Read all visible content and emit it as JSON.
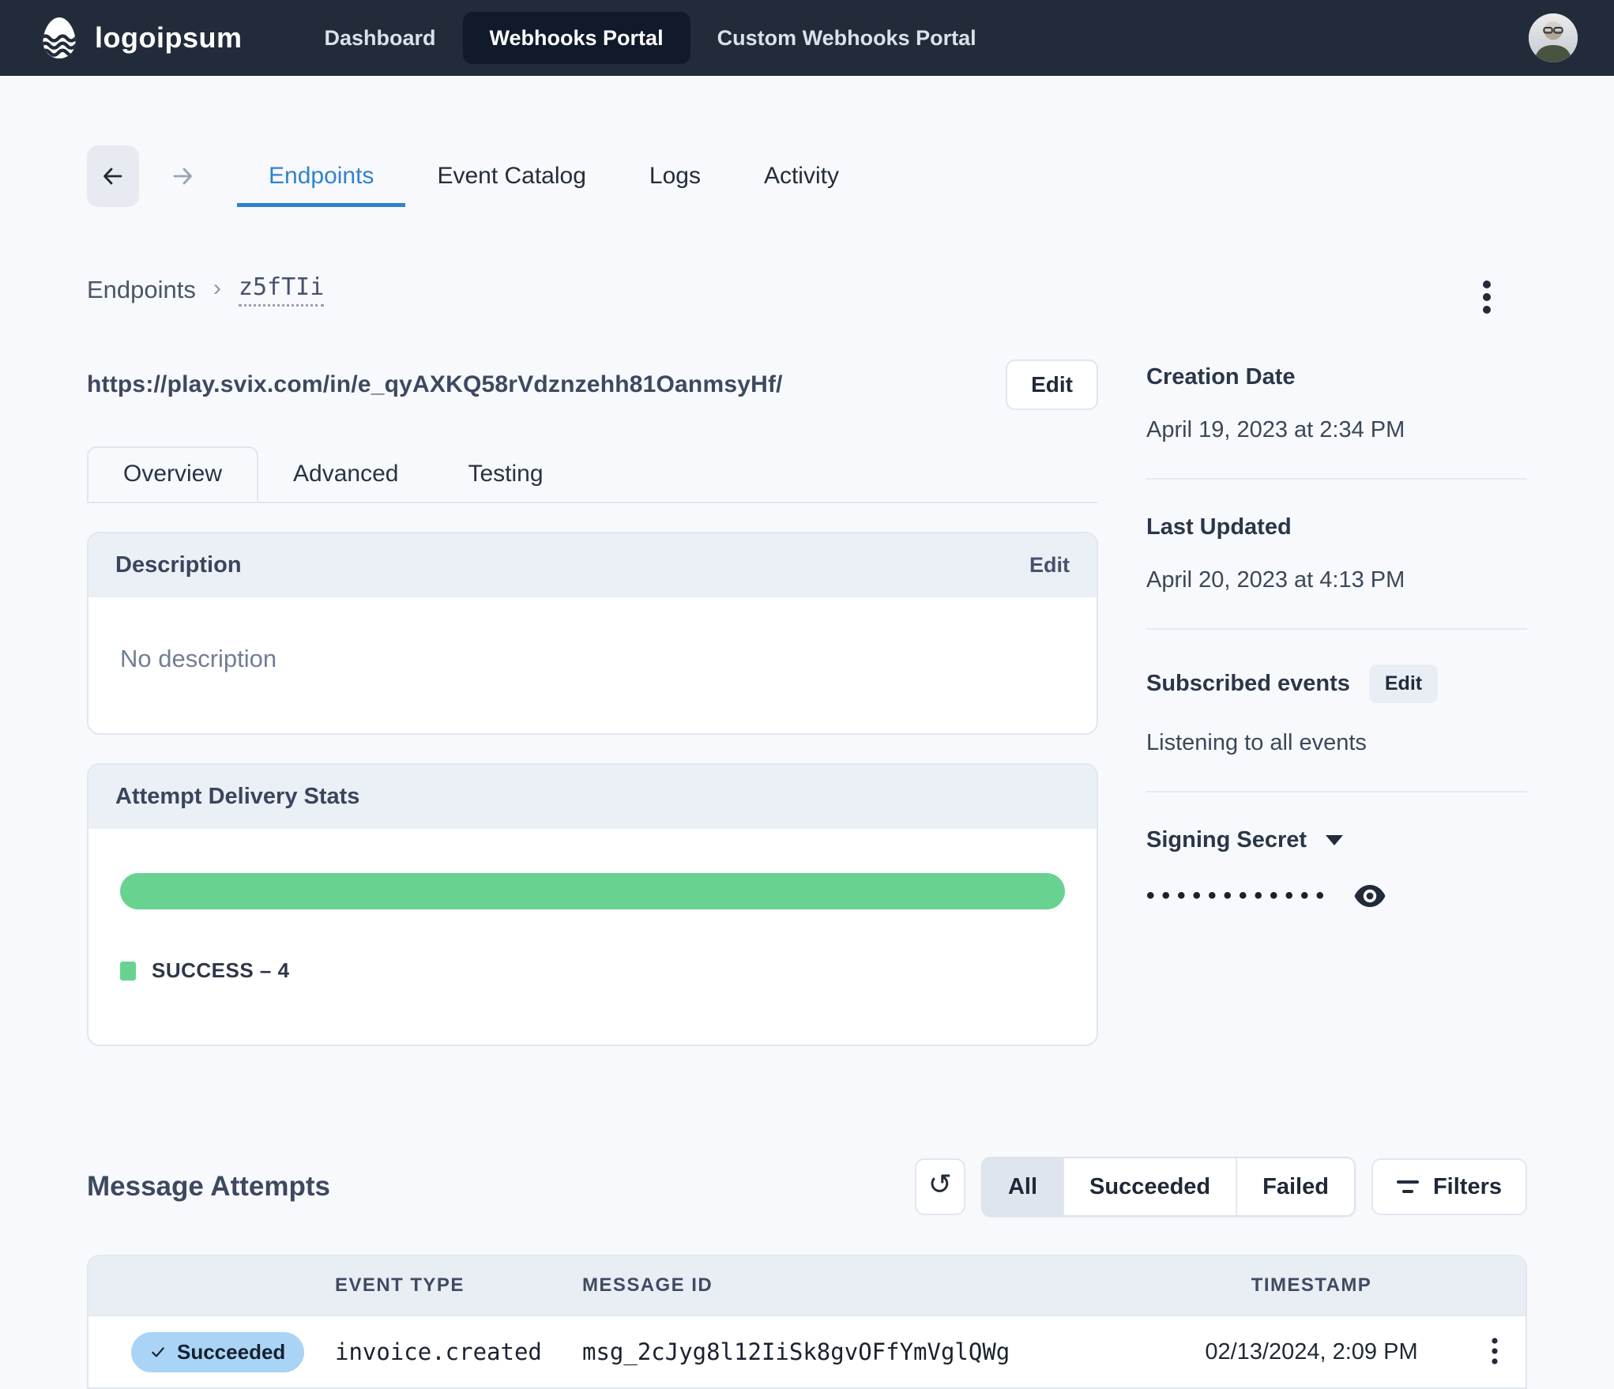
{
  "theme": {
    "navbar_bg": "#222b3a",
    "navbar_active_bg": "#111a2b",
    "accent_blue": "#3182ce",
    "success_green": "#68d391",
    "succeeded_badge_bg": "#aad4f5"
  },
  "navbar": {
    "logo_text": "logoipsum",
    "items": [
      {
        "label": "Dashboard",
        "active": false
      },
      {
        "label": "Webhooks Portal",
        "active": true
      },
      {
        "label": "Custom Webhooks Portal",
        "active": false
      }
    ]
  },
  "portal_tabs": {
    "items": [
      {
        "label": "Endpoints",
        "active": true
      },
      {
        "label": "Event Catalog",
        "active": false
      },
      {
        "label": "Logs",
        "active": false
      },
      {
        "label": "Activity",
        "active": false
      }
    ]
  },
  "breadcrumb": {
    "root": "Endpoints",
    "separator": "›",
    "current": "z5fTIi"
  },
  "endpoint": {
    "url": "https://play.svix.com/in/e_qyAXKQ58rVdznzehh81OanmsyHf/",
    "edit_button": "Edit"
  },
  "detail_tabs": {
    "items": [
      {
        "label": "Overview",
        "active": true
      },
      {
        "label": "Advanced",
        "active": false
      },
      {
        "label": "Testing",
        "active": false
      }
    ]
  },
  "description_card": {
    "title": "Description",
    "edit_button": "Edit",
    "empty_text": "No description"
  },
  "delivery_stats": {
    "title": "Attempt Delivery Stats",
    "legend_label": "SUCCESS – 4",
    "series": [
      {
        "name": "SUCCESS",
        "count": 4,
        "percent": 100,
        "color": "#68d391"
      }
    ]
  },
  "sidebar": {
    "creation_date_label": "Creation Date",
    "creation_date_value": "April 19, 2023 at 2:34 PM",
    "last_updated_label": "Last Updated",
    "last_updated_value": "April 20, 2023 at 4:13 PM",
    "subscribed_events_label": "Subscribed events",
    "subscribed_events_edit": "Edit",
    "subscribed_events_value": "Listening to all events",
    "signing_secret_label": "Signing Secret",
    "signing_secret_masked": "••••••••••••"
  },
  "message_attempts": {
    "title": "Message Attempts",
    "segments": [
      {
        "label": "All",
        "active": true
      },
      {
        "label": "Succeeded",
        "active": false
      },
      {
        "label": "Failed",
        "active": false
      }
    ],
    "filters_button": "Filters",
    "table": {
      "columns": [
        "EVENT TYPE",
        "MESSAGE ID",
        "TIMESTAMP"
      ],
      "rows": [
        {
          "status": "Succeeded",
          "event_type": "invoice.created",
          "message_id": "msg_2cJyg8l12IiSk8gvOFfYmVglQWg",
          "timestamp": "02/13/2024, 2:09 PM"
        }
      ]
    }
  }
}
